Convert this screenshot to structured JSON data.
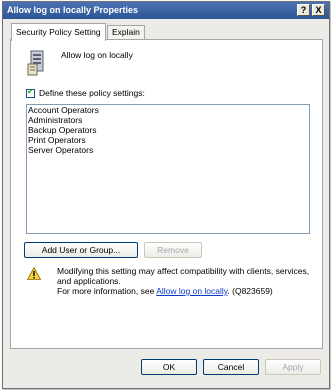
{
  "window": {
    "title": "Allow log on locally Properties",
    "help_glyph": "?",
    "close_glyph": "X"
  },
  "tabs": [
    {
      "label": "Security Policy Setting",
      "active": true
    },
    {
      "label": "Explain",
      "active": false
    }
  ],
  "policy": {
    "icon": "policy-server-icon",
    "name": "Allow log on locally"
  },
  "define_checkbox": {
    "label": "Define these policy settings:",
    "checked": true
  },
  "accounts": [
    "Account Operators",
    "Administrators",
    "Backup Operators",
    "Print Operators",
    "Server Operators"
  ],
  "actions": {
    "add_label": "Add User or Group...",
    "remove_label": "Remove"
  },
  "warning": {
    "icon": "warning-icon",
    "line1": "Modifying this setting may affect compatibility with clients, services, and applications.",
    "prefix": "For more information, see ",
    "link_text": "Allow log on locally",
    "suffix": ". (Q823659)"
  },
  "footer": {
    "ok_label": "OK",
    "cancel_label": "Cancel",
    "apply_label": "Apply"
  }
}
